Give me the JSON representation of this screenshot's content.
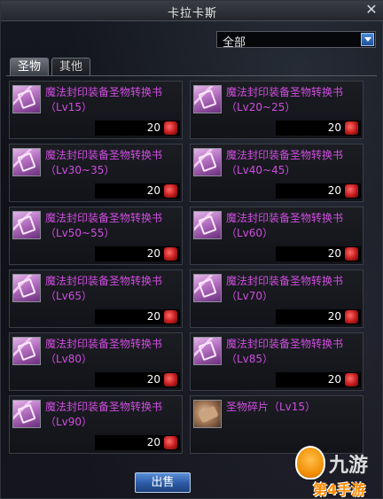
{
  "window": {
    "title": "卡拉卡斯"
  },
  "filter": {
    "selected": "全部"
  },
  "tabs": [
    {
      "label": "圣物",
      "active": true
    },
    {
      "label": "其他",
      "active": false
    }
  ],
  "items": [
    {
      "name": "魔法封印装备圣物转换书（Lv15）",
      "price": "20",
      "icon": "scroll-icon"
    },
    {
      "name": "魔法封印装备圣物转换书（Lv20~25）",
      "price": "20",
      "icon": "scroll-icon"
    },
    {
      "name": "魔法封印装备圣物转换书（Lv30~35）",
      "price": "20",
      "icon": "scroll-icon"
    },
    {
      "name": "魔法封印装备圣物转换书（Lv40~45）",
      "price": "20",
      "icon": "scroll-icon"
    },
    {
      "name": "魔法封印装备圣物转换书（Lv50~55）",
      "price": "20",
      "icon": "scroll-icon"
    },
    {
      "name": "魔法封印装备圣物转换书（Lv60）",
      "price": "20",
      "icon": "scroll-icon"
    },
    {
      "name": "魔法封印装备圣物转换书（Lv65）",
      "price": "20",
      "icon": "scroll-icon"
    },
    {
      "name": "魔法封印装备圣物转换书（Lv70）",
      "price": "20",
      "icon": "scroll-icon"
    },
    {
      "name": "魔法封印装备圣物转换书（Lv80）",
      "price": "20",
      "icon": "scroll-icon"
    },
    {
      "name": "魔法封印装备圣物转换书（Lv85）",
      "price": "20",
      "icon": "scroll-icon"
    },
    {
      "name": "魔法封印装备圣物转换书（Lv90）",
      "price": "20",
      "icon": "scroll-icon"
    },
    {
      "name": "圣物碎片（Lv15）",
      "price": "",
      "icon": "fragment-icon"
    }
  ],
  "footer": {
    "sell_label": "出售"
  },
  "watermark": {
    "text1": "九游",
    "text2": "第4手游"
  },
  "colors": {
    "item_name": "#d04de0",
    "accent_button": "#2b5aa5"
  }
}
